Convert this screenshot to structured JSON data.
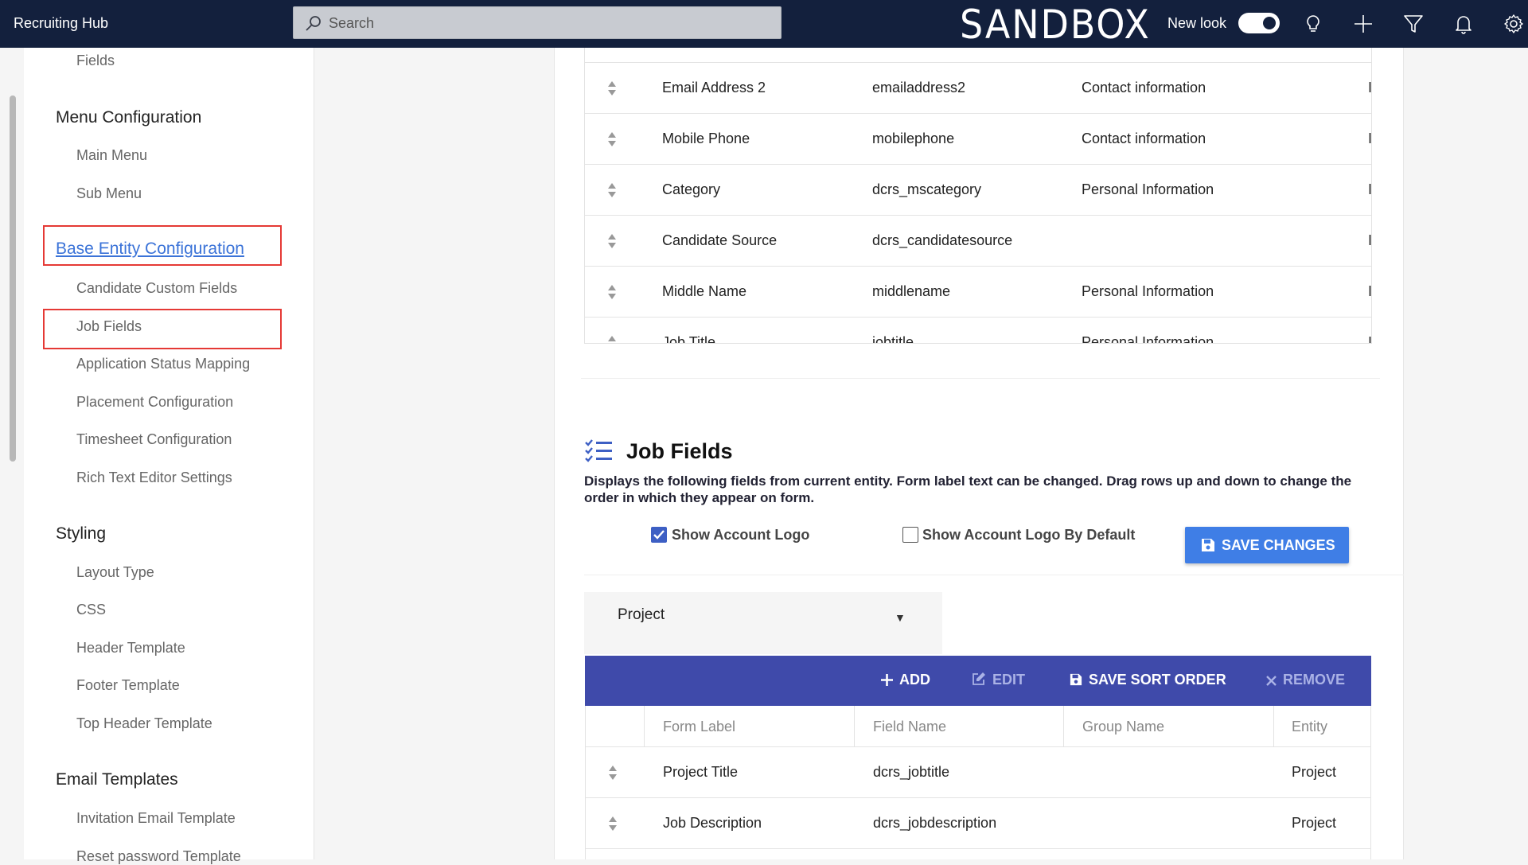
{
  "app": {
    "title": "Recruiting Hub",
    "environment": "SANDBOX"
  },
  "search": {
    "placeholder": "Search"
  },
  "header": {
    "new_look_label": "New look",
    "new_look_enabled": true,
    "icons": [
      "lightbulb-icon",
      "plus-icon",
      "filter-icon",
      "bell-icon",
      "gear-icon"
    ]
  },
  "sidebar": {
    "fields_item": "Fields",
    "menu_config": {
      "title": "Menu Configuration",
      "items": [
        "Main Menu",
        "Sub Menu"
      ]
    },
    "base_entity": {
      "title": "Base Entity Configuration",
      "items": [
        "Candidate Custom Fields",
        "Job Fields",
        "Application Status Mapping",
        "Placement Configuration",
        "Timesheet Configuration",
        "Rich Text Editor Settings"
      ]
    },
    "styling": {
      "title": "Styling",
      "items": [
        "Layout Type",
        "CSS",
        "Header Template",
        "Footer Template",
        "Top Header Template"
      ]
    },
    "email_templates": {
      "title": "Email Templates",
      "items": [
        "Invitation Email Template",
        "Reset password Template"
      ]
    }
  },
  "candidate_table": {
    "rows": [
      {
        "label": "Email Address 2",
        "field": "emailaddress2",
        "group": "Contact information",
        "entity": "I"
      },
      {
        "label": "Mobile Phone",
        "field": "mobilephone",
        "group": "Contact information",
        "entity": "I"
      },
      {
        "label": "Category",
        "field": "dcrs_mscategory",
        "group": "Personal Information",
        "entity": "I"
      },
      {
        "label": "Candidate Source",
        "field": "dcrs_candidatesource",
        "group": "",
        "entity": "I"
      },
      {
        "label": "Middle Name",
        "field": "middlename",
        "group": "Personal Information",
        "entity": "I"
      },
      {
        "label": "Job Title",
        "field": "jobtitle",
        "group": "Personal Information",
        "entity": "I"
      }
    ]
  },
  "job_fields": {
    "title": "Job Fields",
    "description": "Displays the following fields from current entity. Form label text can be changed. Drag rows up and down to change the order in which they appear on form.",
    "show_logo": {
      "label": "Show Account Logo",
      "checked": true
    },
    "show_logo_default": {
      "label": "Show Account Logo By Default",
      "checked": false
    },
    "save_label": "SAVE CHANGES",
    "entity_select": {
      "value": "Project"
    },
    "toolbar": {
      "add": "ADD",
      "edit": "EDIT",
      "save_sort": "SAVE SORT ORDER",
      "remove": "REMOVE"
    },
    "columns": {
      "form_label": "Form Label",
      "field_name": "Field Name",
      "group_name": "Group Name",
      "entity": "Entity"
    },
    "rows": [
      {
        "label": "Project Title",
        "field": "dcrs_jobtitle",
        "group": "",
        "entity": "Project"
      },
      {
        "label": "Job Description",
        "field": "dcrs_jobdescription",
        "group": "",
        "entity": "Project"
      }
    ]
  },
  "colors": {
    "topbar": "#13203d",
    "toolbar": "#3f4aaa",
    "primary_button": "#3f7ee6",
    "link": "#3b73d8",
    "highlight": "#e53935"
  }
}
